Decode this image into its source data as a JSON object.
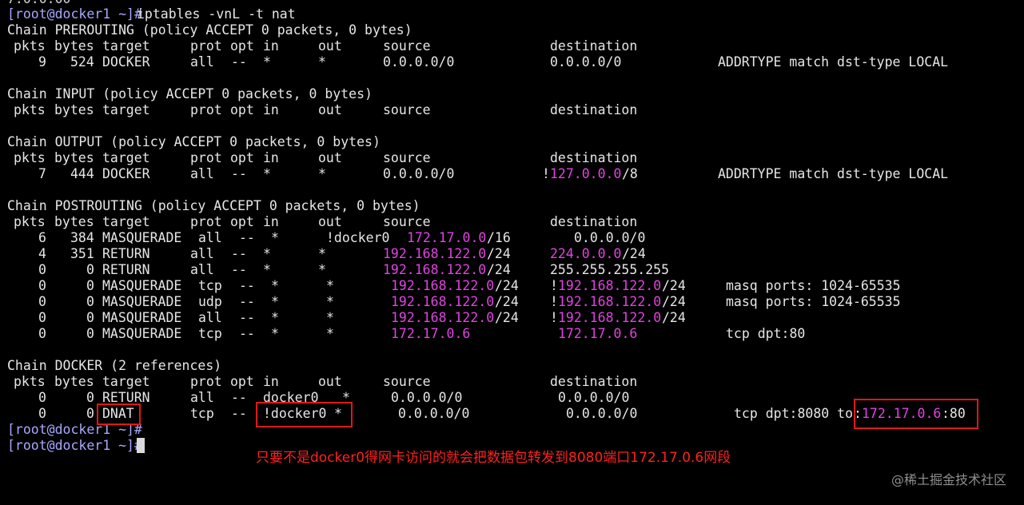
{
  "terminal": {
    "top_partial": "7.0.0.00",
    "command": {
      "prompt": "[root@docker1 ~]#",
      "text": "iptables -vnL -t nat"
    },
    "header": {
      "pkts": "pkts",
      "bytes": "bytes",
      "target": "target",
      "prot": "prot",
      "opt": "opt",
      "in": "in",
      "out": "out",
      "source": "source",
      "destination": "destination"
    },
    "chains": {
      "prerouting": {
        "title": "Chain PREROUTING (policy ACCEPT 0 packets, 0 bytes)",
        "rows": [
          {
            "pkts": "9",
            "bytes": "524",
            "target": "DOCKER",
            "prot": "all",
            "opt": "--",
            "in": "*",
            "out": "*",
            "source": "0.0.0.0/0",
            "destination": "0.0.0.0/0",
            "extra": "ADDRTYPE match dst-type LOCAL"
          }
        ]
      },
      "input": {
        "title": "Chain INPUT (policy ACCEPT 0 packets, 0 bytes)"
      },
      "output": {
        "title": "Chain OUTPUT (policy ACCEPT 0 packets, 0 bytes)",
        "rows": [
          {
            "pkts": "7",
            "bytes": "444",
            "target": "DOCKER",
            "prot": "all",
            "opt": "--",
            "in": "*",
            "out": "*",
            "source": "0.0.0.0/0",
            "dest_neg": "!",
            "destination": "127.0.0.0",
            "dest_mask": "/8",
            "extra": "ADDRTYPE match dst-type LOCAL"
          }
        ]
      },
      "postrouting": {
        "title": "Chain POSTROUTING (policy ACCEPT 0 packets, 0 bytes)",
        "rows": [
          {
            "pkts": "6",
            "bytes": "384",
            "target": "MASQUERADE",
            "prot": "all",
            "opt": "--",
            "in": "*",
            "out": "!docker0",
            "source": "172.17.0.0",
            "source_mask": "/16",
            "destination": "0.0.0.0/0",
            "extra": ""
          },
          {
            "pkts": "4",
            "bytes": "351",
            "target": "RETURN",
            "prot": "all",
            "opt": "--",
            "in": "*",
            "out": "*",
            "source": "192.168.122.0",
            "source_mask": "/24",
            "destination": "224.0.0.0",
            "dest_mask": "/24",
            "extra": ""
          },
          {
            "pkts": "0",
            "bytes": "0",
            "target": "RETURN",
            "prot": "all",
            "opt": "--",
            "in": "*",
            "out": "*",
            "source": "192.168.122.0",
            "source_mask": "/24",
            "destination": "255.255.255.255",
            "extra": ""
          },
          {
            "pkts": "0",
            "bytes": "0",
            "target": "MASQUERADE",
            "prot": "tcp",
            "opt": "--",
            "in": "*",
            "out": "*",
            "source": "192.168.122.0",
            "source_mask": "/24",
            "dest_neg": "!",
            "destination": "192.168.122.0",
            "dest_mask": "/24",
            "extra": "masq ports: 1024-65535"
          },
          {
            "pkts": "0",
            "bytes": "0",
            "target": "MASQUERADE",
            "prot": "udp",
            "opt": "--",
            "in": "*",
            "out": "*",
            "source": "192.168.122.0",
            "source_mask": "/24",
            "dest_neg": "!",
            "destination": "192.168.122.0",
            "dest_mask": "/24",
            "extra": "masq ports: 1024-65535"
          },
          {
            "pkts": "0",
            "bytes": "0",
            "target": "MASQUERADE",
            "prot": "all",
            "opt": "--",
            "in": "*",
            "out": "*",
            "source": "192.168.122.0",
            "source_mask": "/24",
            "dest_neg": "!",
            "destination": "192.168.122.0",
            "dest_mask": "/24",
            "extra": ""
          },
          {
            "pkts": "0",
            "bytes": "0",
            "target": "MASQUERADE",
            "prot": "tcp",
            "opt": "--",
            "in": "*",
            "out": "*",
            "source": "172.17.0.6",
            "destination": "172.17.0.6",
            "extra": "tcp dpt:80"
          }
        ]
      },
      "docker": {
        "title": "Chain DOCKER (2 references)",
        "rows": [
          {
            "pkts": "0",
            "bytes": "0",
            "target": "RETURN",
            "prot": "all",
            "opt": "--",
            "in": "docker0",
            "out": "*",
            "source": "0.0.0.0/0",
            "destination": "0.0.0.0/0",
            "extra": ""
          },
          {
            "pkts": "0",
            "bytes": "0",
            "target": "DNAT",
            "prot": "tcp",
            "opt": "--",
            "in": "!docker0",
            "out": "*",
            "source": "0.0.0.0/0",
            "destination": "0.0.0.0/0",
            "extra_prefix": "tcp dpt:8080 to",
            "extra_colon": ":",
            "extra_ip": "172.17.0.6",
            "extra_port": ":80"
          }
        ]
      }
    },
    "prompt_lines": [
      "[root@docker1 ~]#",
      "[root@docker1 ~]#"
    ]
  },
  "annotation": {
    "note": "只要不是docker0得网卡访问的就会把数据包转发到8080端口172.17.0.6网段",
    "watermark": "@稀土掘金技术社区",
    "color": "#e01818"
  }
}
